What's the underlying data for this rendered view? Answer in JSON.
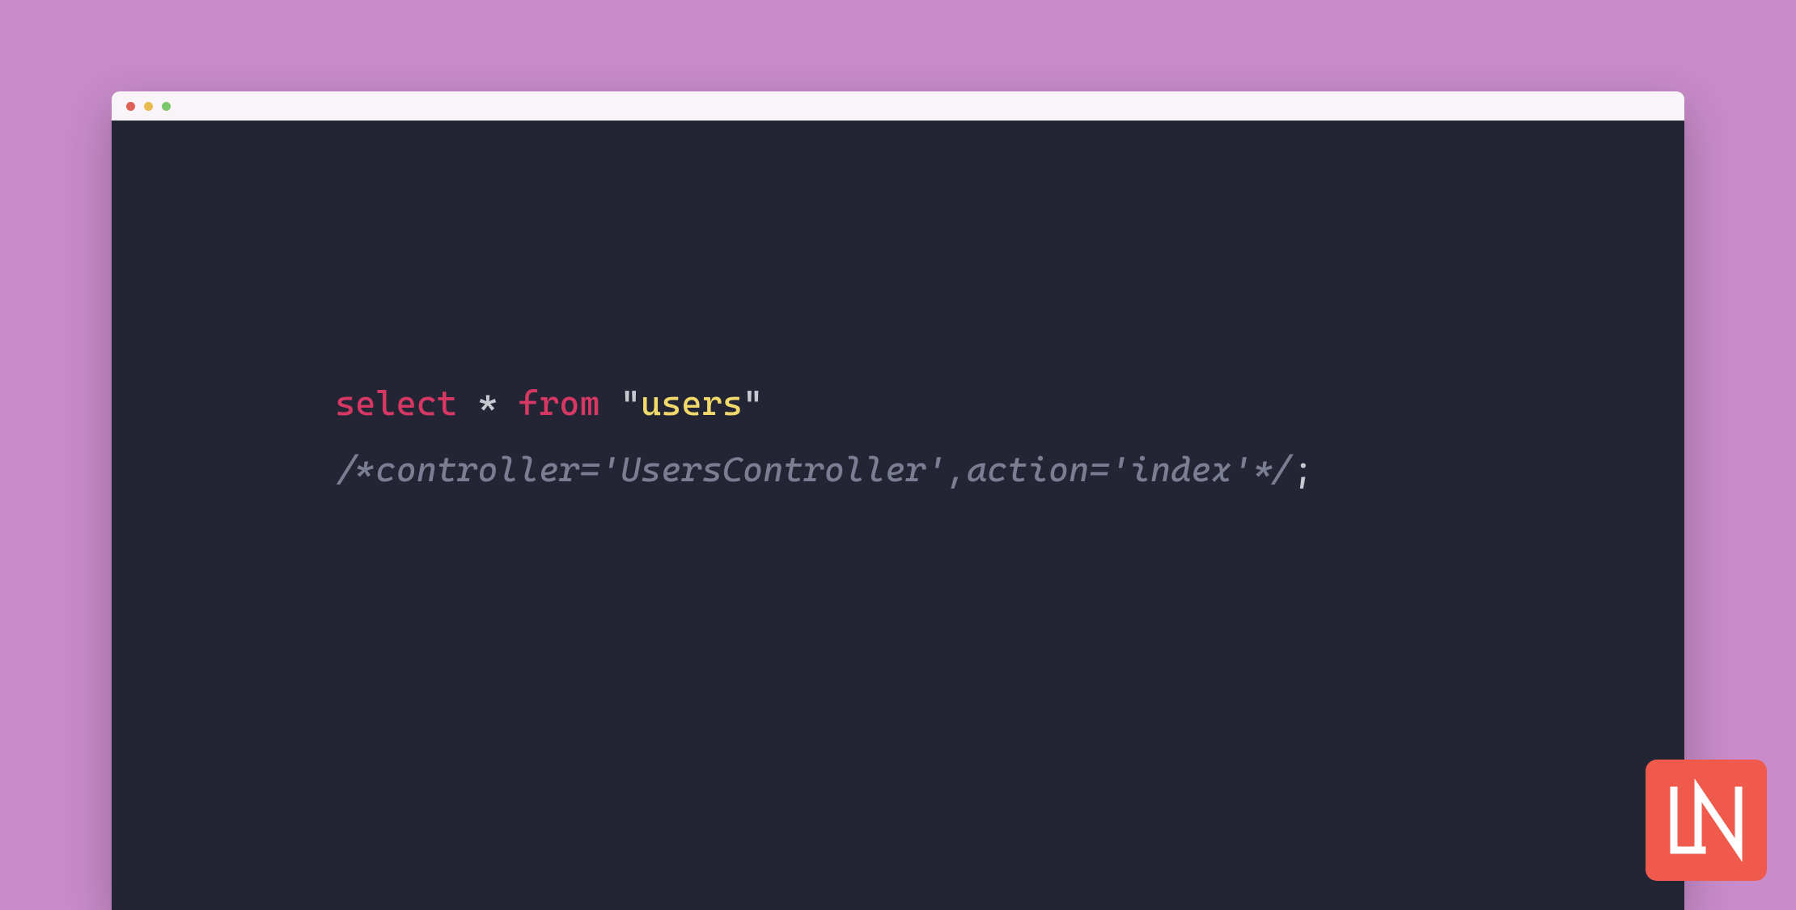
{
  "colors": {
    "page_bg": "#c98bc9",
    "titlebar_bg": "#f9f4f7",
    "editor_bg": "#232535",
    "keyword": "#d63863",
    "string": "#f1d96b",
    "comment": "#7b7e93",
    "default": "#c8c8d0",
    "logo_bg": "#ef5a4c",
    "traffic_close": "#e06055",
    "traffic_min": "#e8bb4e",
    "traffic_max": "#7cc66b"
  },
  "code": {
    "line1": {
      "select": "select",
      "star": " * ",
      "from": "from",
      "space": " ",
      "q1": "\"",
      "users": "users",
      "q2": "\""
    },
    "line2": {
      "comment": "/*controller='UsersController',action='index'*/",
      "semicolon": ";"
    }
  },
  "logo": {
    "text": "LN"
  }
}
